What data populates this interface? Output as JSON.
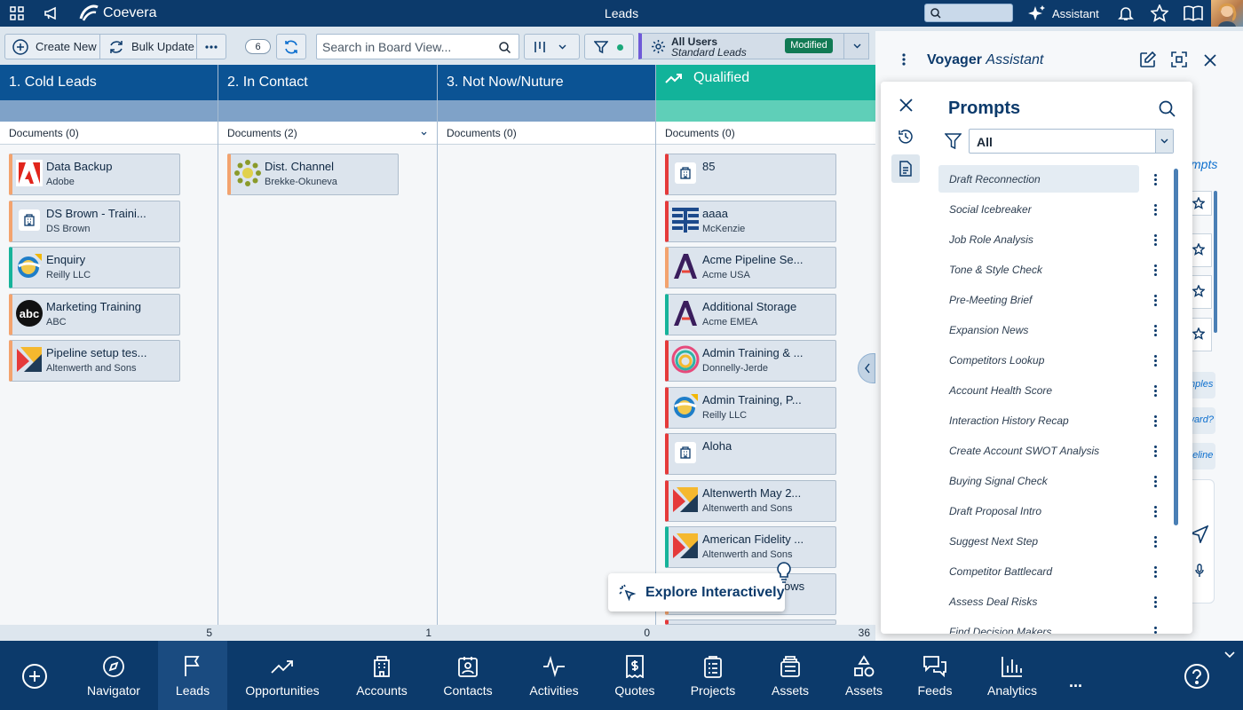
{
  "topbar": {
    "brand": "Coevera",
    "title": "Leads",
    "assistant_label": "Assistant"
  },
  "toolbar": {
    "create_new": "Create New",
    "bulk_update": "Bulk Update",
    "count": "6",
    "search_placeholder": "Search in Board View...",
    "view_title": "All Users",
    "view_subtitle": "Standard Leads",
    "view_badge": "Modified"
  },
  "columns": [
    {
      "title": "1. Cold Leads",
      "docs": "Documents (0)",
      "count": "5",
      "head_color": "#0b5394"
    },
    {
      "title": "2. In Contact",
      "docs": "Documents (2)",
      "count": "1",
      "head_color": "#0b5394"
    },
    {
      "title": "3. Not Now/Nuture",
      "docs": "Documents (0)",
      "count": "0",
      "head_color": "#0b5394"
    },
    {
      "title": "Qualified",
      "docs": "Documents (0)",
      "count": "36",
      "head_color": "#12b39a"
    }
  ],
  "cards": {
    "c0": [
      {
        "title": "Data Backup",
        "sub": "Adobe",
        "logo": "adobe-logo"
      },
      {
        "title": "DS Brown - Traini...",
        "sub": "DS Brown",
        "logo": "building-icon"
      },
      {
        "title": "Enquiry",
        "sub": "Reilly LLC",
        "logo": "reilly-logo"
      },
      {
        "title": "Marketing Training",
        "sub": "ABC",
        "logo": "abc-logo"
      },
      {
        "title": "Pipeline setup tes...",
        "sub": "Altenwerth and Sons",
        "logo": "altenwerth-logo"
      }
    ],
    "c1": [
      {
        "title": "Dist. Channel",
        "sub": "Brekke-Okuneva",
        "logo": "brekke-logo"
      }
    ],
    "c3": [
      {
        "title": "85",
        "sub": "",
        "logo": "building-icon"
      },
      {
        "title": "aaaa",
        "sub": "McKenzie",
        "logo": "mckenzie-logo"
      },
      {
        "title": "Acme Pipeline Se...",
        "sub": "Acme USA",
        "logo": "acme-logo"
      },
      {
        "title": "Additional Storage",
        "sub": "Acme EMEA",
        "logo": "acme-logo"
      },
      {
        "title": "Admin Training & ...",
        "sub": "Donnelly-Jerde",
        "logo": "donnelly-logo"
      },
      {
        "title": "Admin Training, P...",
        "sub": "Reilly LLC",
        "logo": "reilly-logo"
      },
      {
        "title": "Aloha",
        "sub": "",
        "logo": "building-icon"
      },
      {
        "title": "Altenwerth May 2...",
        "sub": "Altenwerth and Sons",
        "logo": "altenwerth-logo"
      },
      {
        "title": "American Fidelity ...",
        "sub": "Altenwerth and Sons",
        "logo": "altenwerth-logo"
      },
      {
        "title": "ows",
        "sub": "",
        "logo": "building-icon"
      }
    ]
  },
  "explore_label": "Explore Interactively",
  "assistant": {
    "title_bold": "Voyager",
    "title_italic": "Assistant",
    "peek": [
      "mpts",
      "mples",
      "ward?",
      "peline"
    ]
  },
  "prompts": {
    "title": "Prompts",
    "filter_value": "All",
    "items": [
      "Draft Reconnection",
      "Social Icebreaker",
      "Job Role Analysis",
      "Tone & Style Check",
      "Pre-Meeting Brief",
      "Expansion News",
      "Competitors Lookup",
      "Account Health Score",
      "Interaction History Recap",
      "Create Account SWOT Analysis",
      "Buying Signal Check",
      "Draft Proposal Intro",
      "Suggest Next Step",
      "Competitor Battlecard",
      "Assess Deal Risks",
      "Find Decision Makers"
    ]
  },
  "bottomnav": {
    "items": [
      "Navigator",
      "Leads",
      "Opportunities",
      "Accounts",
      "Contacts",
      "Activities",
      "Quotes",
      "Projects",
      "Assets",
      "Assets",
      "Feeds",
      "Analytics"
    ],
    "more": "..."
  }
}
